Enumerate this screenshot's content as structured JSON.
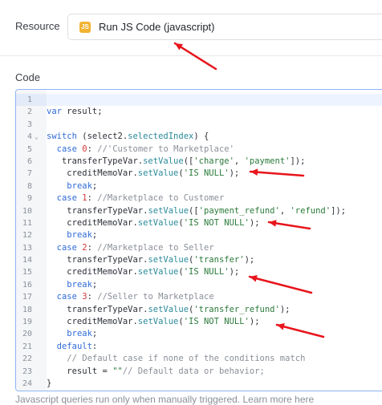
{
  "resource": {
    "label": "Resource",
    "badge": "JS",
    "value": "Run JS Code (javascript)"
  },
  "code_section": {
    "label": "Code"
  },
  "code_lines": [
    {
      "n": "1",
      "fold": "",
      "tokens": []
    },
    {
      "n": "2",
      "fold": "",
      "tokens": [
        {
          "t": "kw",
          "v": "var"
        },
        {
          "t": "p",
          "v": " result;"
        }
      ]
    },
    {
      "n": "3",
      "fold": "",
      "tokens": []
    },
    {
      "n": "4",
      "fold": "⌄",
      "tokens": [
        {
          "t": "kw",
          "v": "switch"
        },
        {
          "t": "p",
          "v": " (select2."
        },
        {
          "t": "fn",
          "v": "selectedIndex"
        },
        {
          "t": "p",
          "v": ") {"
        }
      ]
    },
    {
      "n": "5",
      "fold": "",
      "tokens": [
        {
          "t": "p",
          "v": "  "
        },
        {
          "t": "kw",
          "v": "case"
        },
        {
          "t": "p",
          "v": " "
        },
        {
          "t": "num",
          "v": "0"
        },
        {
          "t": "p",
          "v": ": "
        },
        {
          "t": "cm",
          "v": "//'Customer to Marketplace'"
        }
      ]
    },
    {
      "n": "6",
      "fold": "",
      "tokens": [
        {
          "t": "p",
          "v": "   transferTypeVar."
        },
        {
          "t": "fn",
          "v": "setValue"
        },
        {
          "t": "p",
          "v": "(["
        },
        {
          "t": "str",
          "v": "'charge'"
        },
        {
          "t": "p",
          "v": ", "
        },
        {
          "t": "str",
          "v": "'payment'"
        },
        {
          "t": "p",
          "v": "]);"
        }
      ]
    },
    {
      "n": "7",
      "fold": "",
      "tokens": [
        {
          "t": "p",
          "v": "    creditMemoVar."
        },
        {
          "t": "fn",
          "v": "setValue"
        },
        {
          "t": "p",
          "v": "("
        },
        {
          "t": "str",
          "v": "'IS NULL'"
        },
        {
          "t": "p",
          "v": ");"
        }
      ]
    },
    {
      "n": "8",
      "fold": "",
      "tokens": [
        {
          "t": "p",
          "v": "    "
        },
        {
          "t": "kw",
          "v": "break"
        },
        {
          "t": "p",
          "v": ";"
        }
      ]
    },
    {
      "n": "9",
      "fold": "",
      "tokens": [
        {
          "t": "p",
          "v": "  "
        },
        {
          "t": "kw",
          "v": "case"
        },
        {
          "t": "p",
          "v": " "
        },
        {
          "t": "num",
          "v": "1"
        },
        {
          "t": "p",
          "v": ": "
        },
        {
          "t": "cm",
          "v": "//Marketplace to Customer"
        }
      ]
    },
    {
      "n": "10",
      "fold": "",
      "tokens": [
        {
          "t": "p",
          "v": "    transferTypeVar."
        },
        {
          "t": "fn",
          "v": "setValue"
        },
        {
          "t": "p",
          "v": "(["
        },
        {
          "t": "str",
          "v": "'payment_refund'"
        },
        {
          "t": "p",
          "v": ", "
        },
        {
          "t": "str",
          "v": "'refund'"
        },
        {
          "t": "p",
          "v": "]);"
        }
      ]
    },
    {
      "n": "11",
      "fold": "",
      "tokens": [
        {
          "t": "p",
          "v": "    creditMemoVar."
        },
        {
          "t": "fn",
          "v": "setValue"
        },
        {
          "t": "p",
          "v": "("
        },
        {
          "t": "str",
          "v": "'IS NOT NULL'"
        },
        {
          "t": "p",
          "v": ");"
        }
      ]
    },
    {
      "n": "12",
      "fold": "",
      "tokens": [
        {
          "t": "p",
          "v": "    "
        },
        {
          "t": "kw",
          "v": "break"
        },
        {
          "t": "p",
          "v": ";"
        }
      ]
    },
    {
      "n": "13",
      "fold": "",
      "tokens": [
        {
          "t": "p",
          "v": "  "
        },
        {
          "t": "kw",
          "v": "case"
        },
        {
          "t": "p",
          "v": " "
        },
        {
          "t": "num",
          "v": "2"
        },
        {
          "t": "p",
          "v": ": "
        },
        {
          "t": "cm",
          "v": "//Marketplace to Seller"
        }
      ]
    },
    {
      "n": "14",
      "fold": "",
      "tokens": [
        {
          "t": "p",
          "v": "    transferTypeVar."
        },
        {
          "t": "fn",
          "v": "setValue"
        },
        {
          "t": "p",
          "v": "("
        },
        {
          "t": "str",
          "v": "'transfer'"
        },
        {
          "t": "p",
          "v": ");"
        }
      ]
    },
    {
      "n": "15",
      "fold": "",
      "tokens": [
        {
          "t": "p",
          "v": "    creditMemoVar."
        },
        {
          "t": "fn",
          "v": "setValue"
        },
        {
          "t": "p",
          "v": "("
        },
        {
          "t": "str",
          "v": "'IS NULL'"
        },
        {
          "t": "p",
          "v": ");"
        }
      ]
    },
    {
      "n": "16",
      "fold": "",
      "tokens": [
        {
          "t": "p",
          "v": "    "
        },
        {
          "t": "kw",
          "v": "break"
        },
        {
          "t": "p",
          "v": ";"
        }
      ]
    },
    {
      "n": "17",
      "fold": "",
      "tokens": [
        {
          "t": "p",
          "v": "  "
        },
        {
          "t": "kw",
          "v": "case"
        },
        {
          "t": "p",
          "v": " "
        },
        {
          "t": "num",
          "v": "3"
        },
        {
          "t": "p",
          "v": ": "
        },
        {
          "t": "cm",
          "v": "//Seller to Marketplace"
        }
      ]
    },
    {
      "n": "18",
      "fold": "",
      "tokens": [
        {
          "t": "p",
          "v": "    transferTypeVar."
        },
        {
          "t": "fn",
          "v": "setValue"
        },
        {
          "t": "p",
          "v": "("
        },
        {
          "t": "str",
          "v": "'transfer_refund'"
        },
        {
          "t": "p",
          "v": ");"
        }
      ]
    },
    {
      "n": "19",
      "fold": "",
      "tokens": [
        {
          "t": "p",
          "v": "    creditMemoVar."
        },
        {
          "t": "fn",
          "v": "setValue"
        },
        {
          "t": "p",
          "v": "("
        },
        {
          "t": "str",
          "v": "'IS NOT NULL'"
        },
        {
          "t": "p",
          "v": ");"
        }
      ]
    },
    {
      "n": "20",
      "fold": "",
      "tokens": [
        {
          "t": "p",
          "v": "    "
        },
        {
          "t": "kw",
          "v": "break"
        },
        {
          "t": "p",
          "v": ";"
        }
      ]
    },
    {
      "n": "21",
      "fold": "",
      "tokens": [
        {
          "t": "p",
          "v": "  "
        },
        {
          "t": "kw",
          "v": "default"
        },
        {
          "t": "p",
          "v": ":"
        }
      ]
    },
    {
      "n": "22",
      "fold": "",
      "tokens": [
        {
          "t": "p",
          "v": "    "
        },
        {
          "t": "cm",
          "v": "// Default case if none of the conditions match"
        }
      ]
    },
    {
      "n": "23",
      "fold": "",
      "tokens": [
        {
          "t": "p",
          "v": "    result = "
        },
        {
          "t": "str",
          "v": "\"\""
        },
        {
          "t": "cm",
          "v": "// Default data or behavior;"
        }
      ]
    },
    {
      "n": "24",
      "fold": "",
      "tokens": [
        {
          "t": "p",
          "v": "}"
        }
      ]
    }
  ],
  "footer": {
    "text": "Javascript queries run only when manually triggered. Learn more here"
  },
  "colors": {
    "annotation_arrow": "#e8141b",
    "editor_border": "#8cb4f5",
    "js_badge": "#f2b233"
  },
  "icons": [
    "js-icon",
    "annotation-arrow"
  ]
}
